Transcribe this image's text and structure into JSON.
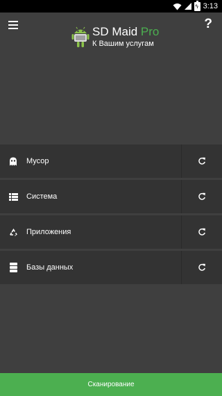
{
  "status_bar": {
    "time": "3:13"
  },
  "header": {
    "title_main": "SD Maid",
    "title_accent": "Pro",
    "subtitle": "К Вашим услугам",
    "help_label": "?",
    "menu_icon": "hamburger-icon",
    "logo_icon": "android-logo-icon"
  },
  "items": [
    {
      "label": "Мусор",
      "icon": "ghost-icon"
    },
    {
      "label": "Система",
      "icon": "list-icon"
    },
    {
      "label": "Приложения",
      "icon": "recycle-icon"
    },
    {
      "label": "Базы данных",
      "icon": "database-icon"
    }
  ],
  "scan_button": {
    "label": "Сканирование"
  },
  "colors": {
    "accent": "#4caf50",
    "background": "#3f3f3f",
    "row_bg": "#333333"
  }
}
